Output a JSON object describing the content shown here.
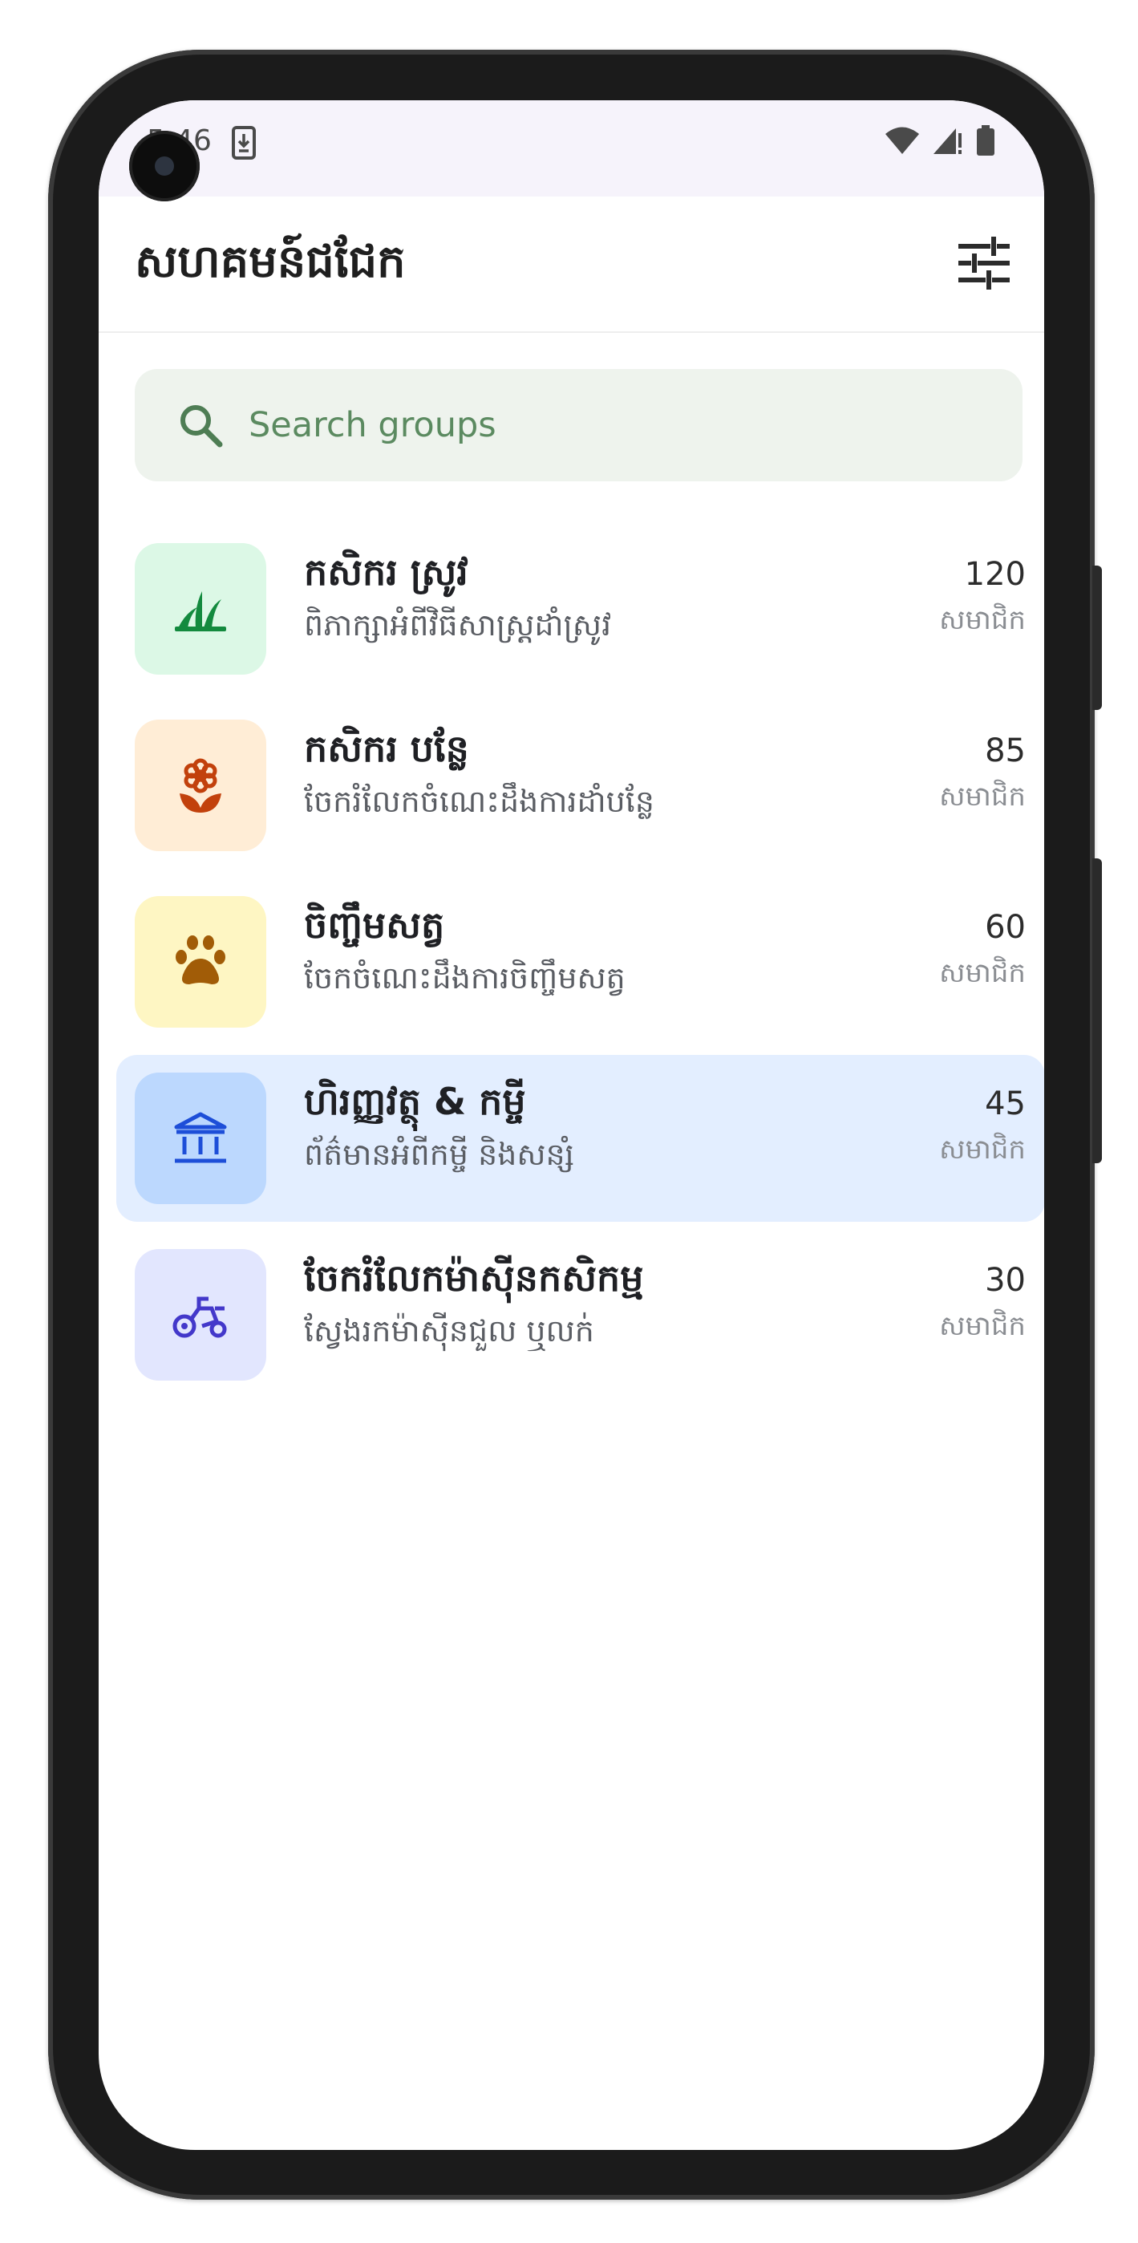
{
  "status": {
    "time": "5:46"
  },
  "appbar": {
    "title": "សហគមន៍ជជែក"
  },
  "search": {
    "placeholder": "Search groups"
  },
  "groups": [
    {
      "name": "កសិករ ស្រូវ",
      "description": "ពិភាក្សាអំពីវិធីសាស្រ្តដាំស្រូវ",
      "count": "120",
      "unit": "សមាជិក",
      "icon": "grass-icon",
      "tile_color": "#dcf8e6",
      "icon_color": "#138a3e"
    },
    {
      "name": "កសិករ បន្លែ",
      "description": "ចែករំលែកចំណេះដឹងការដាំបន្លែ",
      "count": "85",
      "unit": "សមាជិក",
      "icon": "flower-icon",
      "tile_color": "#ffedd6",
      "icon_color": "#c2410c"
    },
    {
      "name": "ចិញ្ចឹមសត្វ",
      "description": "ចែកចំណេះដឹងការចិញ្ចឹមសត្វ",
      "count": "60",
      "unit": "សមាជិក",
      "icon": "paw-icon",
      "tile_color": "#fef6c3",
      "icon_color": "#a15c07"
    },
    {
      "name": "ហិរញ្ញវត្ថុ & កម្ចី",
      "description": "ព័ត៌មានអំពីកម្ចី និងសន្សំ",
      "count": "45",
      "unit": "សមាជិក",
      "icon": "bank-icon",
      "tile_color": "#bcd8fe",
      "icon_color": "#1d4ed8",
      "selected": true
    },
    {
      "name": "ចែករំលែកម៉ាស៊ីនកសិកម្ម",
      "description": "ស្វែងរកម៉ាស៊ីនជួល ឬលក់",
      "count": "30",
      "unit": "សមាជិក",
      "icon": "tractor-icon",
      "tile_color": "#e2e6fe",
      "icon_color": "#4338ca"
    }
  ]
}
